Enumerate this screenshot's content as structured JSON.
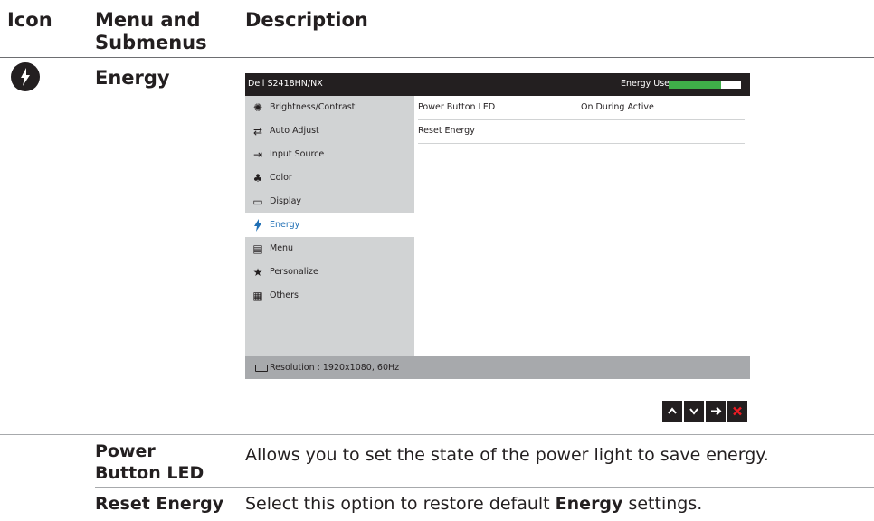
{
  "table": {
    "headers": {
      "icon": "Icon",
      "menu": "Menu and\nSubmenus",
      "desc": "Description"
    },
    "menu_name": "Energy"
  },
  "osd": {
    "model": "Dell S2418HN/NX",
    "energy_use_label": "Energy Use",
    "energy_use_level": 0.72,
    "accent_color": "#1f6fb5",
    "bar_color": "#3fae49",
    "menu_items": [
      {
        "label": "Brightness/Contrast",
        "icon": "sun-icon"
      },
      {
        "label": "Auto Adjust",
        "icon": "auto-adjust-icon"
      },
      {
        "label": "Input Source",
        "icon": "input-source-icon"
      },
      {
        "label": "Color",
        "icon": "color-icon"
      },
      {
        "label": "Display",
        "icon": "display-icon"
      },
      {
        "label": "Energy",
        "icon": "energy-icon",
        "selected": true
      },
      {
        "label": "Menu",
        "icon": "menu-icon"
      },
      {
        "label": "Personalize",
        "icon": "star-icon"
      },
      {
        "label": "Others",
        "icon": "others-icon"
      }
    ],
    "options": [
      {
        "name": "Power Button LED",
        "value": "On During Active"
      },
      {
        "name": "Reset Energy",
        "value": ""
      }
    ],
    "resolution": "Resolution : 1920x1080, 60Hz",
    "nav_buttons": [
      "up",
      "down",
      "right",
      "exit"
    ]
  },
  "rows": [
    {
      "label": "Power\nButton LED",
      "desc": "Allows you to set the state of the power light to save energy."
    },
    {
      "label": "Reset Energy",
      "desc_pre": "Select this option to restore default ",
      "desc_bold": "Energy",
      "desc_post": " settings."
    }
  ]
}
